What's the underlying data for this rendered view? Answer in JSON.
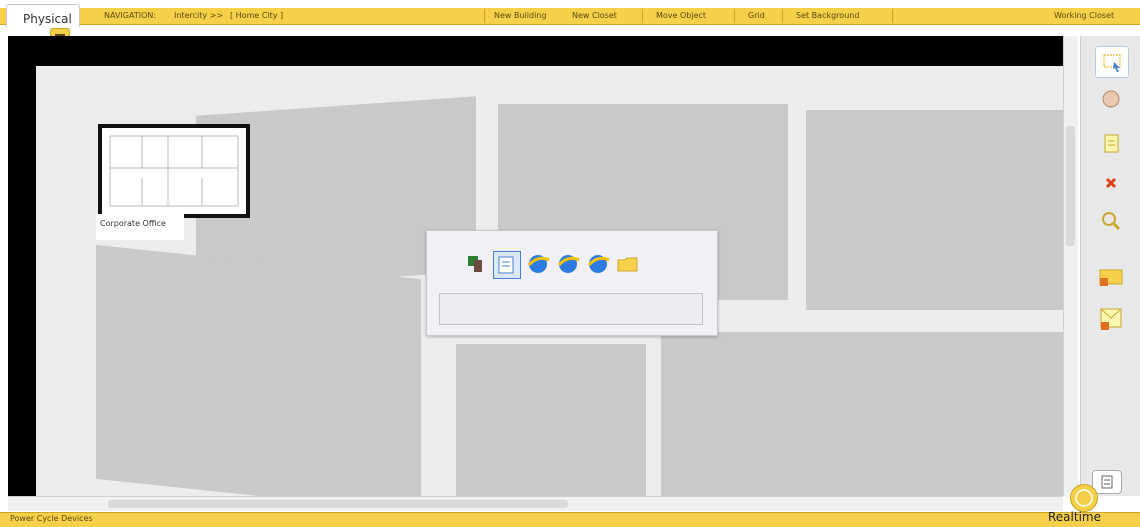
{
  "topbar": {
    "physical_tab": "Physical",
    "navigation": "NAVIGATION:",
    "intercity": "Intercity >>",
    "home_city": "[ Home City ]",
    "new_building": "New Building",
    "new_closet": "New Closet",
    "move_object": "Move Object",
    "grid": "Grid",
    "set_background": "Set Background",
    "working_closet": "Working Closet"
  },
  "canvas": {
    "office_label": "Corporate Office"
  },
  "popup": {
    "icons": [
      "device-icon",
      "edit-icon",
      "browser-icon-1",
      "browser-icon-2",
      "browser-icon-3",
      "folder-icon"
    ],
    "input_value": ""
  },
  "right_toolbar": {
    "icons": [
      "select-icon",
      "move-icon",
      "note-icon",
      "delete-icon",
      "zoom-icon",
      "pdu-icon",
      "complex-pdu-icon"
    ]
  },
  "statusbar": {
    "text": "Power Cycle Devices",
    "mode": "Realtime"
  },
  "colors": {
    "toolbar": "#f7d04a",
    "map_background": "#ececec",
    "map_blocks": "#c9c9c9"
  }
}
